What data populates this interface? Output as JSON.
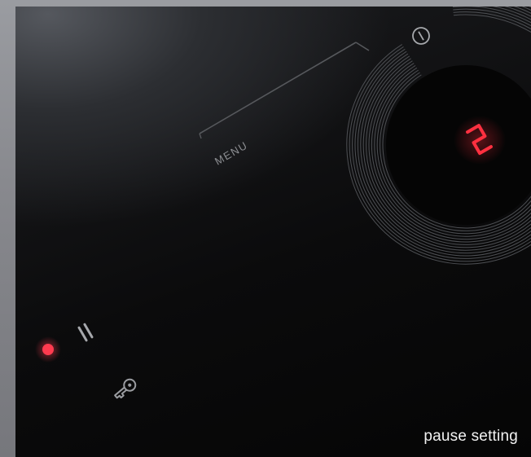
{
  "menu_label": "MENU",
  "display_value": "2",
  "caption": "pause setting",
  "colors": {
    "indicator_red": "#ff3b4f",
    "display_red": "#ff3040",
    "ring_lines": "#5a5c60",
    "icon_grey": "#a6a8ac"
  },
  "icons": {
    "power": "power-icon",
    "pause": "pause-icon",
    "lock": "key-lock-icon",
    "indicator": "indicator-dot"
  },
  "state": {
    "pause_active": true
  }
}
